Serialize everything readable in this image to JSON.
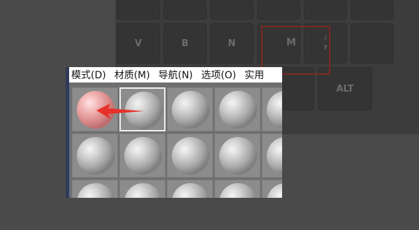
{
  "keyboard": {
    "row2_keys": [
      "V",
      "B",
      "N",
      "M",
      "",
      ""
    ],
    "alt_label": "ALT",
    "small_symbols": [
      "/",
      "?"
    ]
  },
  "menubar": {
    "items": [
      "模式(D)",
      "材质(M)",
      "导航(N)",
      "选项(O)",
      "实用"
    ]
  },
  "material_slots": {
    "rows": 3,
    "cols": 5,
    "active_slot": 2,
    "selected_sample": 1,
    "selected_color": "#e9a7a7"
  },
  "colors": {
    "arrow": "#e8312a",
    "highlight_box": "#7a2a25"
  }
}
